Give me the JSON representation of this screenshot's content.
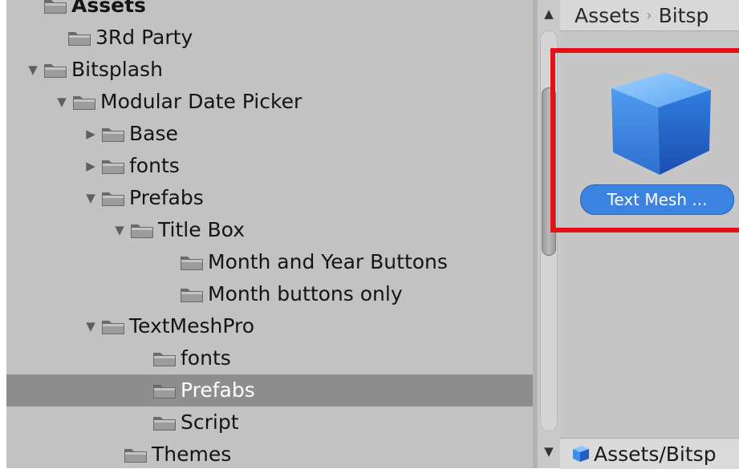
{
  "tree": {
    "items": [
      {
        "label": "Assets",
        "arrow": ""
      },
      {
        "label": "3Rd Party",
        "arrow": ""
      },
      {
        "label": "Bitsplash",
        "arrow": "▼"
      },
      {
        "label": "Modular Date Picker",
        "arrow": "▼"
      },
      {
        "label": "Base",
        "arrow": "▶"
      },
      {
        "label": "fonts",
        "arrow": "▶"
      },
      {
        "label": "Prefabs",
        "arrow": "▼"
      },
      {
        "label": "Title Box",
        "arrow": "▼"
      },
      {
        "label": "Month and Year Buttons",
        "arrow": ""
      },
      {
        "label": "Month buttons only",
        "arrow": ""
      },
      {
        "label": "TextMeshPro",
        "arrow": "▼"
      },
      {
        "label": "fonts",
        "arrow": ""
      },
      {
        "label": "Prefabs",
        "arrow": "",
        "selected": true
      },
      {
        "label": "Script",
        "arrow": ""
      },
      {
        "label": "Themes",
        "arrow": ""
      }
    ]
  },
  "scrollbar": {
    "up_icon": "▲",
    "down_icon": "▼"
  },
  "breadcrumb": {
    "first": "Assets",
    "separator": "›",
    "second": "Bitsp"
  },
  "asset": {
    "label": "Text Mesh ...",
    "icon": "cube-icon"
  },
  "bottom_bar": {
    "path": "Assets/Bitsp"
  },
  "colors": {
    "panel_bg": "#c2c2c2",
    "selected_row": "#8e8e8e",
    "highlight_border": "#e4101a",
    "asset_label_bg": "#3c82e0",
    "cube_blue": "#3a8ee6"
  }
}
